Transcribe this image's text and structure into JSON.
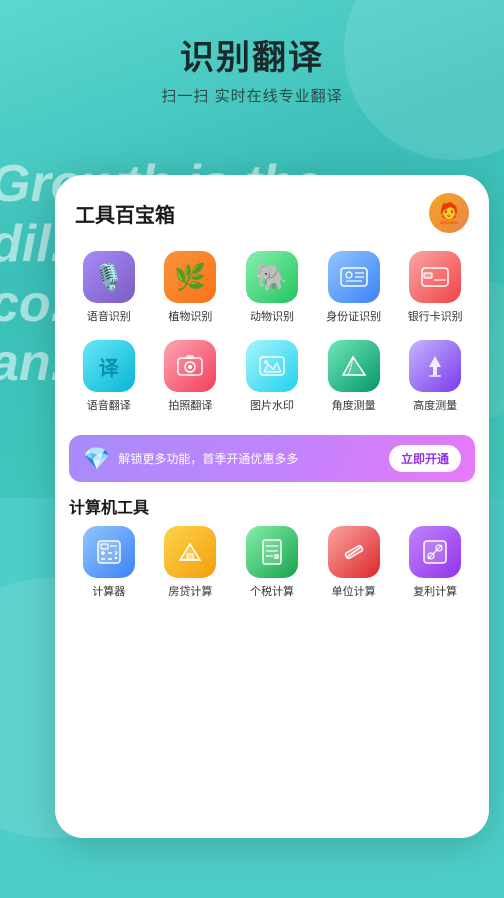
{
  "page": {
    "title": "识别翻译",
    "subtitle": "扫一扫 实时在线专业翻译",
    "bg_text_lines": [
      "Growth is the",
      "dil",
      "co",
      "an"
    ]
  },
  "card": {
    "title": "工具百宝箱",
    "avatar_emoji": "🧑‍🦰"
  },
  "tools_row1": [
    {
      "label": "语音识别",
      "icon": "🎙️",
      "style": "icon-voice"
    },
    {
      "label": "植物识别",
      "icon": "🌿",
      "style": "icon-plant"
    },
    {
      "label": "动物识别",
      "icon": "🐘",
      "style": "icon-animal"
    },
    {
      "label": "身份证识别",
      "icon": "🪪",
      "style": "icon-id"
    },
    {
      "label": "银行卡识别",
      "icon": "💳",
      "style": "icon-bank"
    }
  ],
  "tools_row2": [
    {
      "label": "语音翻译",
      "icon": "译",
      "style": "icon-translate"
    },
    {
      "label": "拍照翻译",
      "icon": "📷",
      "style": "icon-photo"
    },
    {
      "label": "图片水印",
      "icon": "🖼️",
      "style": "icon-watermark"
    },
    {
      "label": "角度测量",
      "icon": "📐",
      "style": "icon-angle"
    },
    {
      "label": "高度测量",
      "icon": "📏",
      "style": "icon-height"
    }
  ],
  "promo": {
    "gem_icon": "💎",
    "text": "解锁更多功能，首季开通优惠多多",
    "button": "立即开通"
  },
  "calc_section": {
    "title": "计算机工具",
    "tools": [
      {
        "label": "计算器",
        "icon": "🖩",
        "style": "icon-calc"
      },
      {
        "label": "房贷计算",
        "icon": "🏠",
        "style": "icon-loan"
      },
      {
        "label": "个税计算",
        "icon": "📅",
        "style": "icon-tax"
      },
      {
        "label": "单位计算",
        "icon": "✏️",
        "style": "icon-unit"
      },
      {
        "label": "复利计算",
        "icon": "💹",
        "style": "icon-compound"
      }
    ]
  }
}
